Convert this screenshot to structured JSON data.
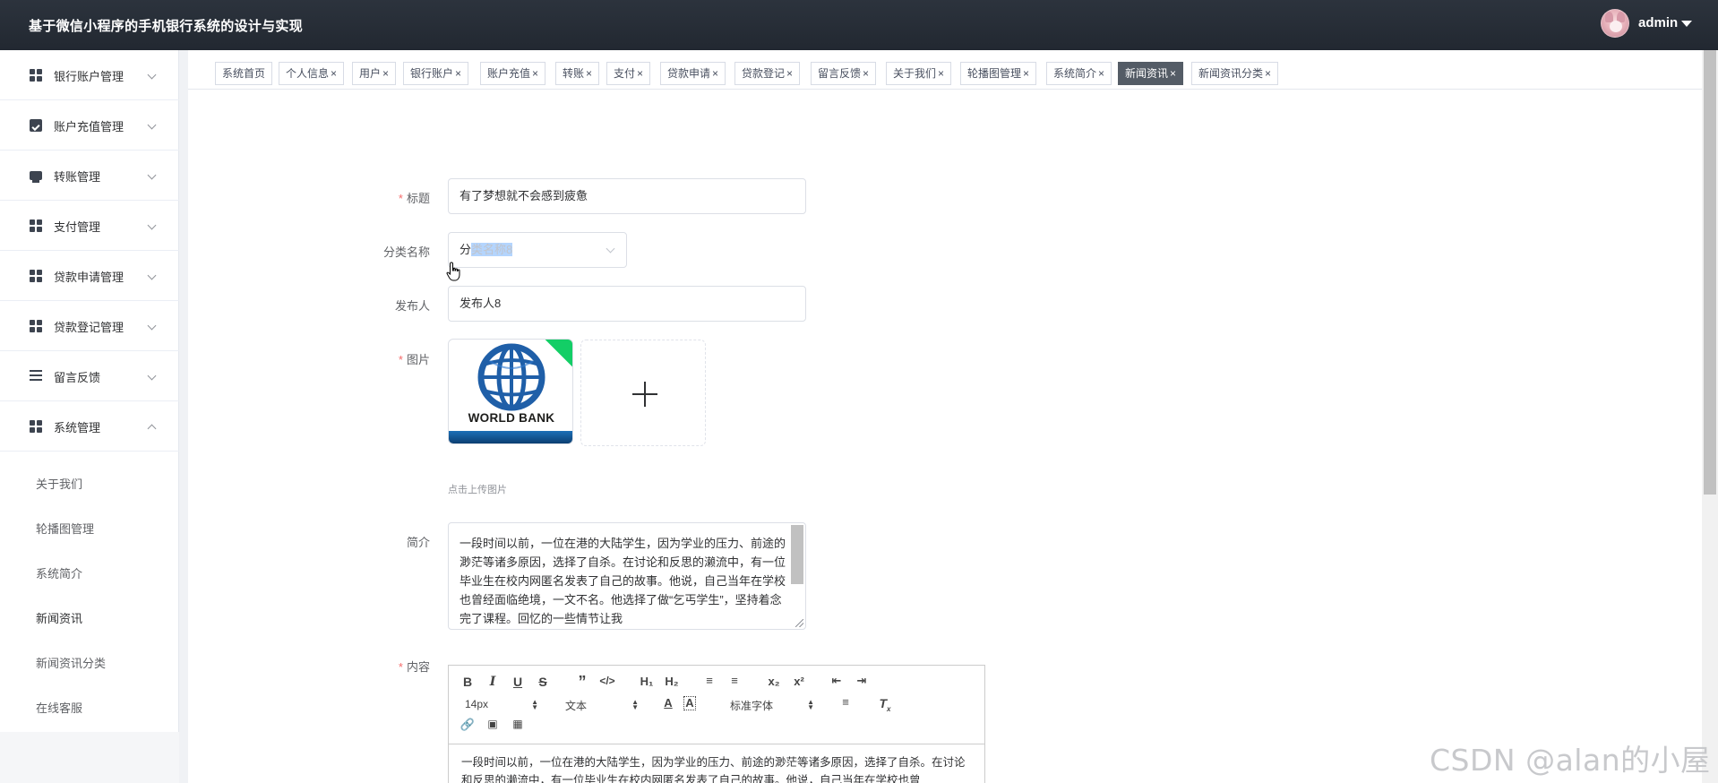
{
  "app": {
    "title": "基于微信小程序的手机银行系统的设计与实现",
    "username": "admin"
  },
  "sidebar": {
    "items": [
      {
        "label": "银行账户管理",
        "icon": "grid-icon"
      },
      {
        "label": "账户充值管理",
        "icon": "clipboard-check-icon"
      },
      {
        "label": "转账管理",
        "icon": "card-icon"
      },
      {
        "label": "支付管理",
        "icon": "grid-icon"
      },
      {
        "label": "贷款申请管理",
        "icon": "grid-icon"
      },
      {
        "label": "贷款登记管理",
        "icon": "grid-icon"
      },
      {
        "label": "留言反馈",
        "icon": "list-icon"
      },
      {
        "label": "系统管理",
        "icon": "grid-icon"
      }
    ],
    "subitems": [
      "关于我们",
      "轮播图管理",
      "系统简介",
      "新闻资讯",
      "新闻资讯分类",
      "在线客服"
    ],
    "active_subitem": "新闻资讯"
  },
  "tabs": {
    "close_glyph": "×",
    "items": [
      {
        "label": "系统首页",
        "closable": false
      },
      {
        "label": "个人信息",
        "closable": true
      },
      {
        "label": "用户",
        "closable": true
      },
      {
        "label": "银行账户",
        "closable": true
      },
      {
        "label": "账户充值",
        "closable": true
      },
      {
        "label": "转账",
        "closable": true
      },
      {
        "label": "支付",
        "closable": true
      },
      {
        "label": "贷款申请",
        "closable": true
      },
      {
        "label": "贷款登记",
        "closable": true
      },
      {
        "label": "留言反馈",
        "closable": true
      },
      {
        "label": "关于我们",
        "closable": true
      },
      {
        "label": "轮播图管理",
        "closable": true
      },
      {
        "label": "系统简介",
        "closable": true
      },
      {
        "label": "新闻资讯",
        "closable": true,
        "active": true
      },
      {
        "label": "新闻资讯分类",
        "closable": true
      }
    ]
  },
  "form": {
    "title_label": "标题",
    "title_value": "有了梦想就不会感到疲惫",
    "category_label": "分类名称",
    "category_value_a": "分",
    "category_value_b": "类名称8",
    "publisher_label": "发布人",
    "publisher_value": "发布人8",
    "image_label": "图片",
    "image_caption": "WORLD BANK",
    "upload_tip": "点击上传图片",
    "summary_label": "简介",
    "summary_value": "一段时间以前，一位在港的大陆学生，因为学业的压力、前途的渺茫等诸多原因，选择了自杀。在讨论和反思的濑流中，有一位毕业生在校内网匿名发表了自己的故事。他说，自己当年在学校也曾经面临绝境，一文不名。他选择了做“乞丐学生”，坚持着念完了课程。回忆的一些情节让我",
    "content_label": "内容",
    "required_mark": "*"
  },
  "editor": {
    "font_size": "14px",
    "block_format": "文本",
    "font_family": "标准字体",
    "body_text": "一段时间以前，一位在港的大陆学生，因为学业的压力、前途的渺茫等诸多原因，选择了自杀。在讨论和反思的濑流中，有一位毕业生在校内网匿名发表了自己的故事。他说，自己当年在学校也曾"
  },
  "watermark": "CSDN @alan的小屋",
  "colors": {
    "header": "#2c333d",
    "active_tab": "#545c66",
    "required": "#f56c6c",
    "upload_badge": "#13ce66"
  }
}
